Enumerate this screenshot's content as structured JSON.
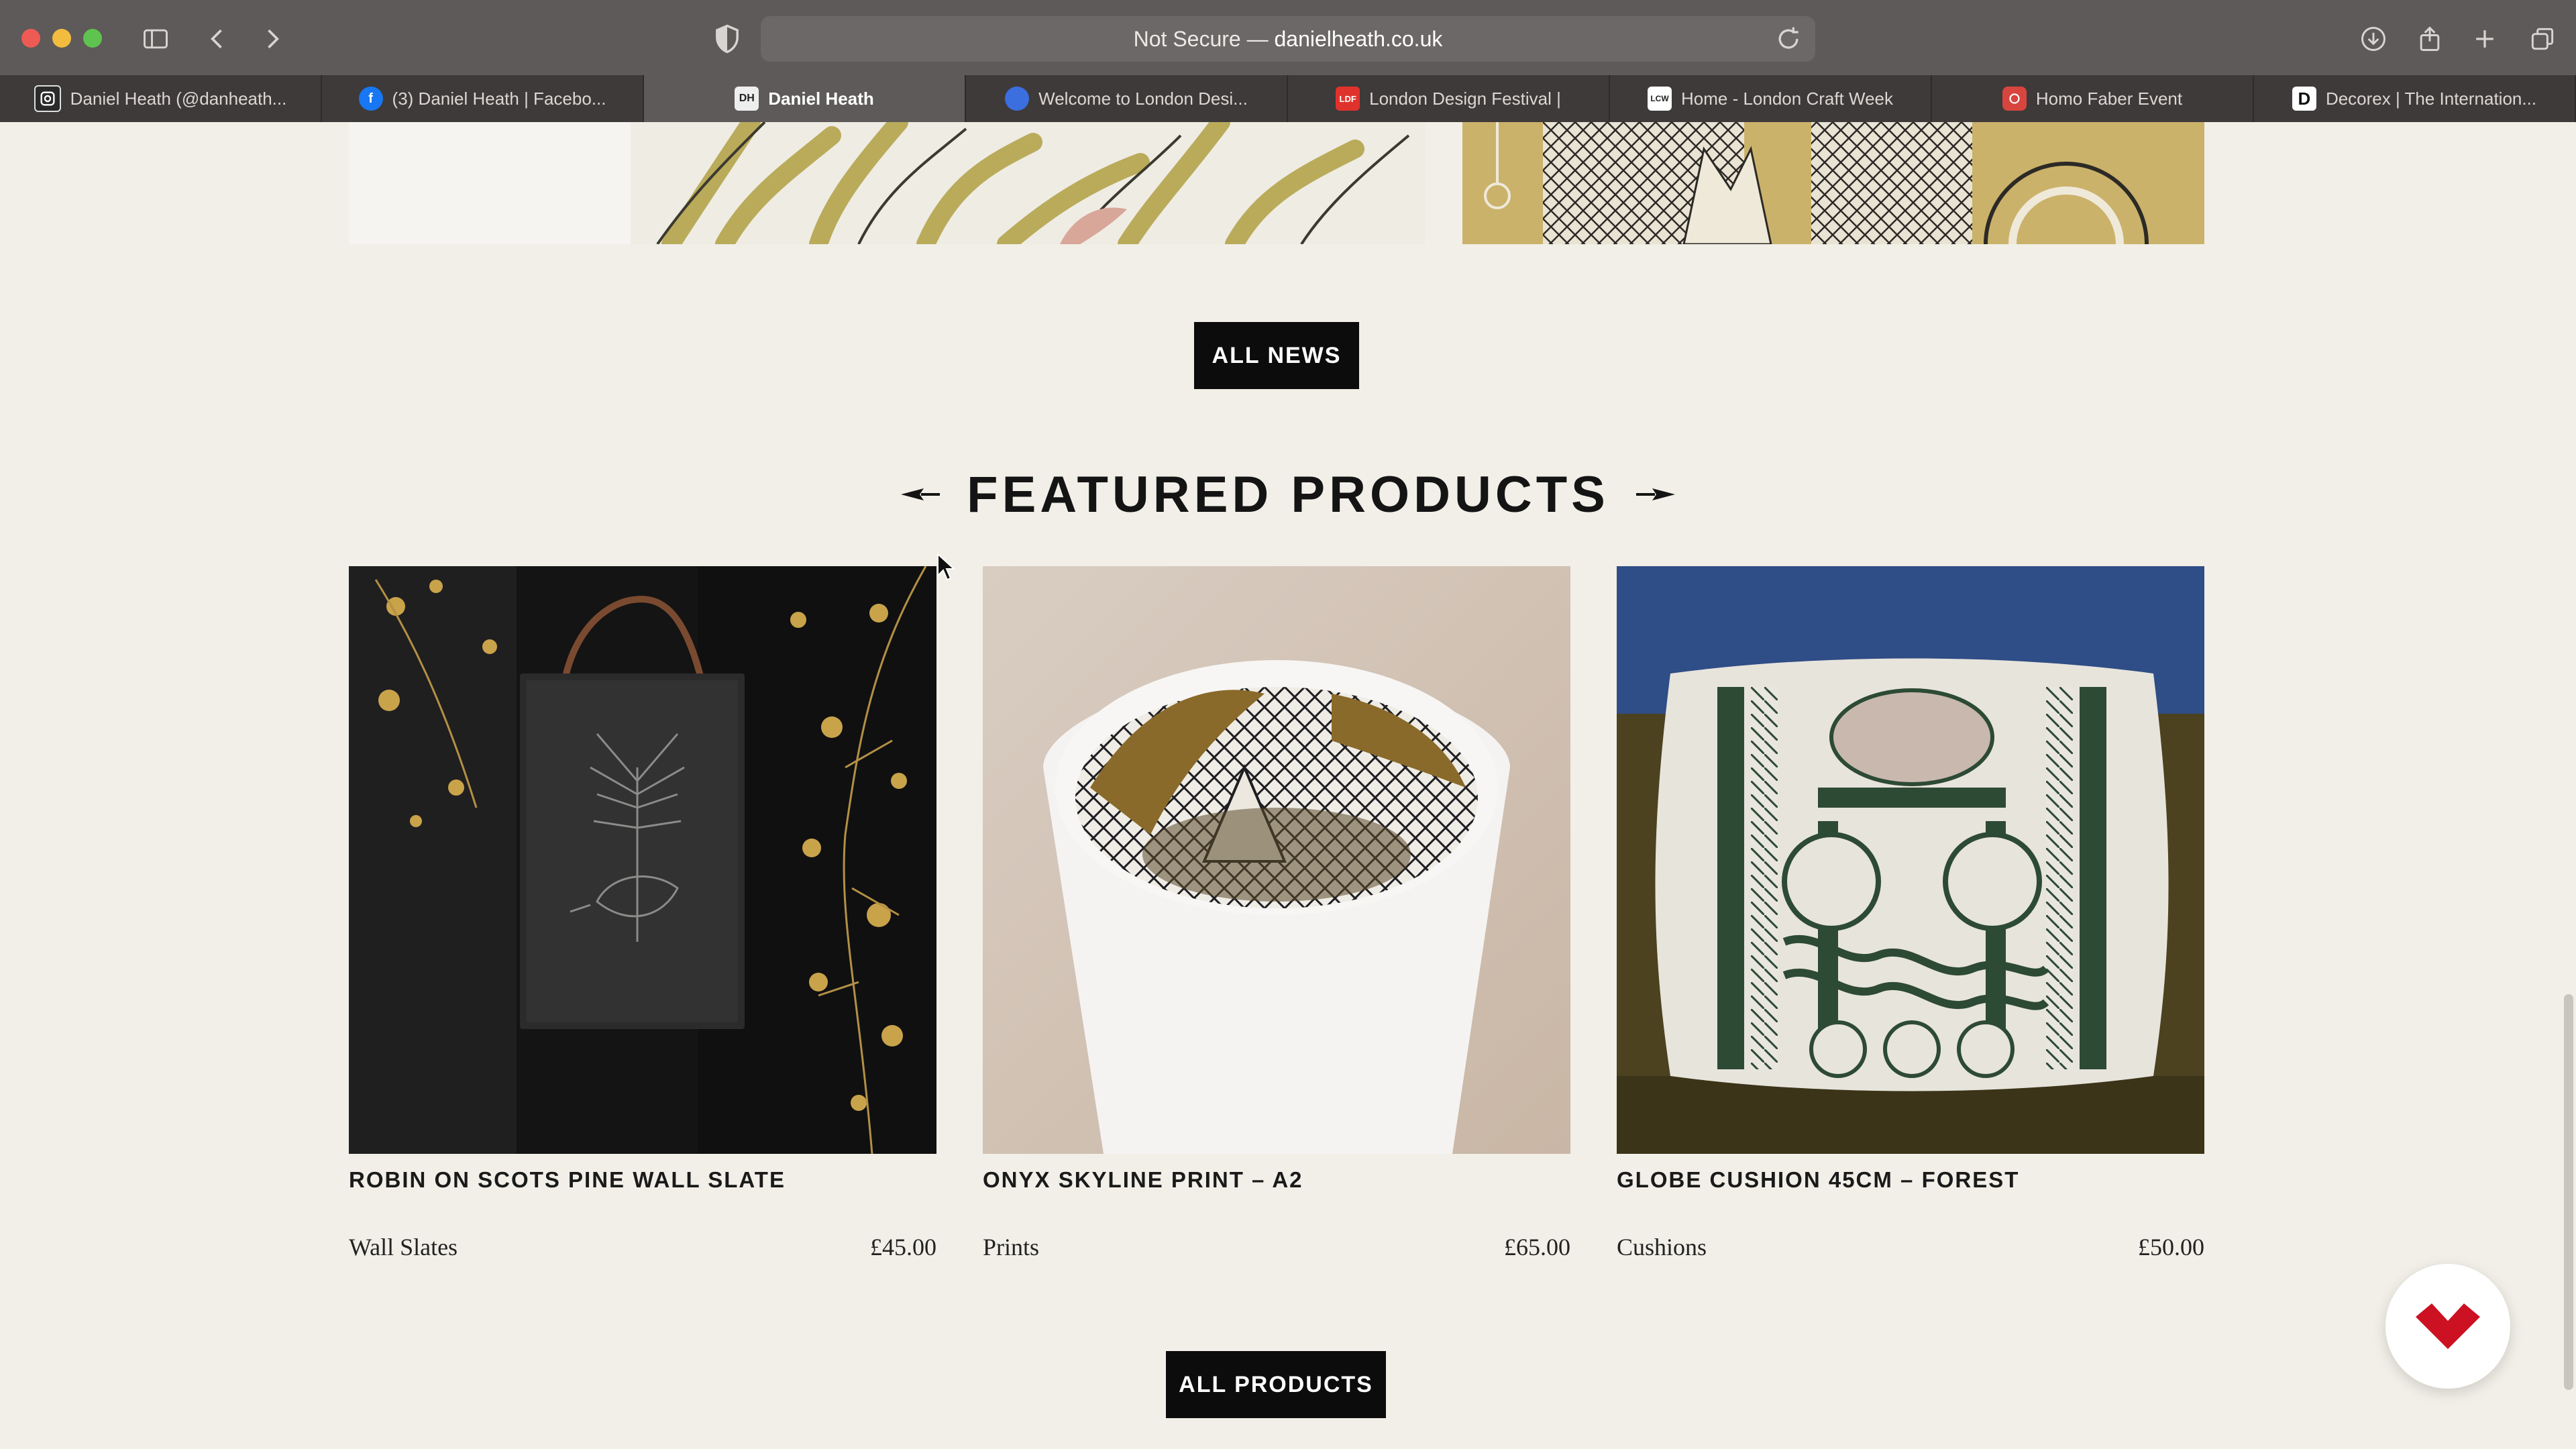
{
  "browser": {
    "url_prefix": "Not Secure — ",
    "url_domain": "danielheath.co.uk",
    "tabs": [
      {
        "label": "Daniel Heath (@danheath...",
        "icon": "instagram-icon",
        "fav_bg": "#333333",
        "fav_text": ""
      },
      {
        "label": "(3) Daniel Heath | Facebo...",
        "icon": "facebook-icon",
        "fav_bg": "#1877f2",
        "fav_text": "f"
      },
      {
        "label": "Daniel Heath",
        "icon": "daniel-heath-icon",
        "fav_bg": "#eeeeee",
        "fav_text": "DH",
        "active": true
      },
      {
        "label": "Welcome to London Desi...",
        "icon": "london-design-icon",
        "fav_bg": "#3b6fe0",
        "fav_text": ""
      },
      {
        "label": "London Design Festival |",
        "icon": "ldf-icon",
        "fav_bg": "#e0322c",
        "fav_text": "LDF"
      },
      {
        "label": "Home - London Craft Week",
        "icon": "lcw-icon",
        "fav_bg": "#ffffff",
        "fav_text": "LCW"
      },
      {
        "label": "Homo Faber Event",
        "icon": "homo-faber-icon",
        "fav_bg": "#d8453e",
        "fav_text": ""
      },
      {
        "label": "Decorex | The Internation...",
        "icon": "decorex-icon",
        "fav_bg": "#ffffff",
        "fav_text": "D"
      }
    ]
  },
  "page": {
    "all_news_label": "ALL NEWS",
    "section_title": "FEATURED PRODUCTS",
    "all_products_label": "ALL PRODUCTS",
    "products": [
      {
        "name": "ROBIN ON SCOTS PINE WALL SLATE",
        "category": "Wall Slates",
        "price": "£45.00"
      },
      {
        "name": "ONYX SKYLINE PRINT – A2",
        "category": "Prints",
        "price": "£65.00"
      },
      {
        "name": "GLOBE CUSHION 45CM – FOREST",
        "category": "Cushions",
        "price": "£50.00"
      }
    ]
  },
  "colors": {
    "page_bg": "#f1efe7",
    "button_bg": "#0c0c0c",
    "chat_accent": "#cc1122"
  }
}
